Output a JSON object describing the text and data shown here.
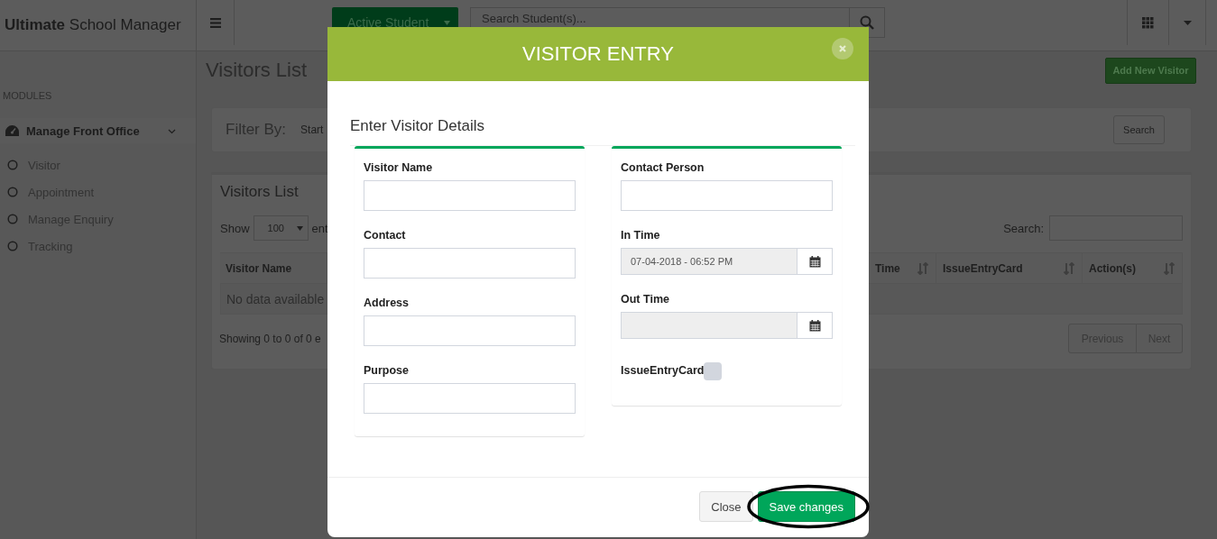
{
  "header": {
    "brand": "**Ultimate** School Manager",
    "student_filter": {
      "label": "Active Student"
    },
    "search": {
      "placeholder": "Search Student(s)..."
    }
  },
  "sidebar": {
    "section": "MODULES",
    "group": {
      "label": "Manage Front Office",
      "expanded": true,
      "items": [
        {
          "label": "Visitor"
        },
        {
          "label": "Appointment"
        },
        {
          "label": "Manage Enquiry"
        },
        {
          "label": "Tracking"
        }
      ]
    }
  },
  "page": {
    "title": "Visitors List",
    "add_button": "Add New Visitor"
  },
  "filter": {
    "label": "Filter By:",
    "field_label": "Start",
    "search_button": "Search"
  },
  "list": {
    "title": "Visitors List",
    "show_label": "Show",
    "page_size": "100",
    "entries_label": "ent",
    "search_label": "Search:",
    "columns": [
      {
        "label": "Visitor Name",
        "sortable": false
      },
      {
        "label": "Time",
        "sortable": true
      },
      {
        "label": "IssueEntryCard",
        "sortable": true
      },
      {
        "label": "Action(s)",
        "sortable": true
      }
    ],
    "empty_text": "No data available",
    "info": "Showing 0 to 0 of 0 e",
    "pager": [
      "Previous",
      "Next"
    ]
  },
  "modal": {
    "title": "VISITOR ENTRY",
    "subtitle": "Enter Visitor Details",
    "left_fields": [
      {
        "label": "Visitor Name",
        "kind": "text"
      },
      {
        "label": "Contact",
        "kind": "text"
      },
      {
        "label": "Address",
        "kind": "text"
      },
      {
        "label": "Purpose",
        "kind": "text"
      }
    ],
    "right_fields": [
      {
        "label": "Contact Person",
        "kind": "text"
      },
      {
        "label": "In Time",
        "kind": "datetime",
        "value": "07-04-2018 - 06:52 PM"
      },
      {
        "label": "Out Time",
        "kind": "datetime"
      },
      {
        "label": "IssueEntryCard",
        "kind": "checkbox",
        "checked": false
      }
    ],
    "buttons": [
      {
        "label": "Close",
        "kind": "default",
        "highlighted": false
      },
      {
        "label": "Save changes",
        "kind": "primary",
        "highlighted": true
      }
    ]
  }
}
